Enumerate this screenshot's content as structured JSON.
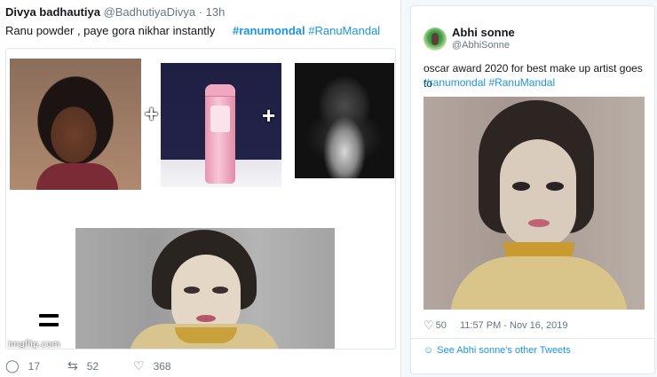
{
  "left_tweet": {
    "name": "Divya badhautiya",
    "handle": "@BadhutiyaDivya",
    "time": "· 13h",
    "text": "Ranu powder , paye gora nikhar instantly",
    "hashtag1": "#ranumondal",
    "hashtag2": "#RanuMandal",
    "watermark": "imgflip.com",
    "actions": {
      "reply_count": "17",
      "retweet_count": "52",
      "like_count": "368"
    },
    "icons": [
      "reply-icon",
      "retweet-icon",
      "heart-icon"
    ]
  },
  "right_tweet": {
    "name": "Abhi sonne",
    "handle": "@AbhiSonne",
    "text": "oscar award 2020 for best make up  artist goes to",
    "hashtag1": "#ranumondal",
    "hashtag2": "#RanuMandal",
    "likes": "50",
    "timestamp": "11:57 PM - Nov 16, 2019",
    "more_link": "See Abhi sonne's other Tweets"
  },
  "colors": {
    "link": "#1b95e0",
    "muted": "#657786",
    "text": "#14171a",
    "border": "#e1e8ed"
  }
}
